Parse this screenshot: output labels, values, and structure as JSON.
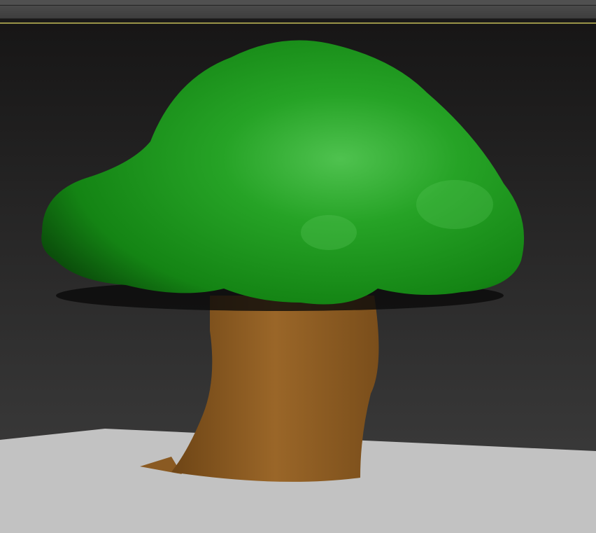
{
  "viewport": {
    "active_border_color": "#9a9448",
    "background_top": "#171616",
    "background_bottom": "#3d3d3d",
    "scene_objects": [
      "canopy",
      "trunk",
      "ground-plane"
    ],
    "colors": {
      "canopy": "#1e9a1e",
      "trunk": "#8a5a22",
      "ground": "#c4c4c4"
    }
  }
}
